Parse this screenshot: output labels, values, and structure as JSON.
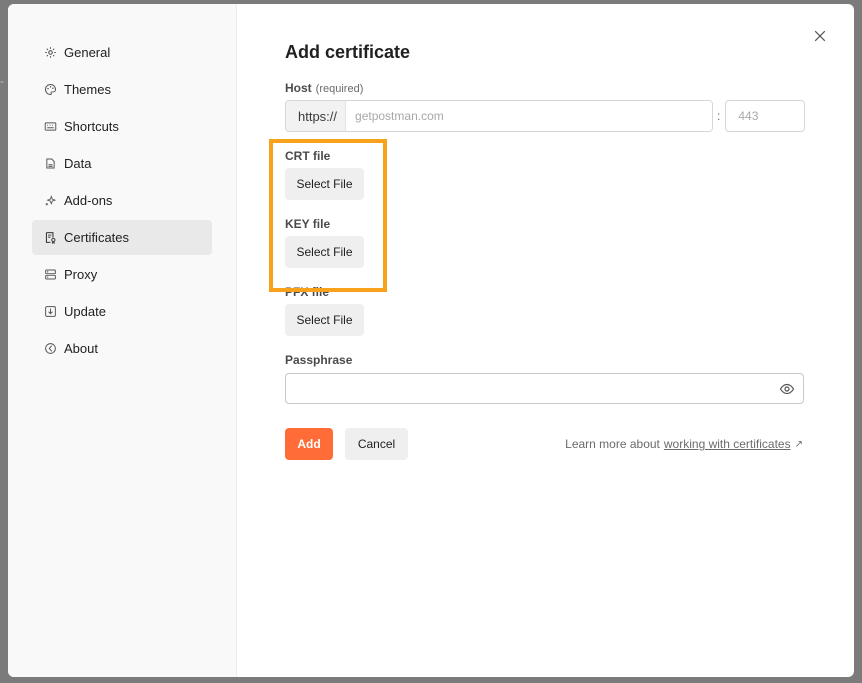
{
  "sidebar": {
    "items": [
      {
        "label": "General",
        "icon": "gear-icon"
      },
      {
        "label": "Themes",
        "icon": "palette-icon"
      },
      {
        "label": "Shortcuts",
        "icon": "keyboard-icon"
      },
      {
        "label": "Data",
        "icon": "database-icon"
      },
      {
        "label": "Add-ons",
        "icon": "sparkle-icon"
      },
      {
        "label": "Certificates",
        "icon": "certificate-icon",
        "active": true
      },
      {
        "label": "Proxy",
        "icon": "proxy-icon"
      },
      {
        "label": "Update",
        "icon": "download-icon"
      },
      {
        "label": "About",
        "icon": "info-icon"
      }
    ]
  },
  "dialog": {
    "title": "Add certificate",
    "host": {
      "label": "Host",
      "hint": "(required)",
      "protocol": "https://",
      "placeholder": "getpostman.com",
      "port_separator": ":",
      "port_placeholder": "443"
    },
    "crt": {
      "label": "CRT file",
      "button": "Select File"
    },
    "key": {
      "label": "KEY file",
      "button": "Select File"
    },
    "pfx": {
      "label": "PFX file",
      "button": "Select File"
    },
    "passphrase": {
      "label": "Passphrase",
      "value": ""
    },
    "add_label": "Add",
    "cancel_label": "Cancel",
    "learn_more_prefix": "Learn more about",
    "learn_more_link": "working with certificates",
    "learn_more_arrow": "↗"
  },
  "colors": {
    "accent": "#ff6c37",
    "highlight": "#f8a21b"
  }
}
